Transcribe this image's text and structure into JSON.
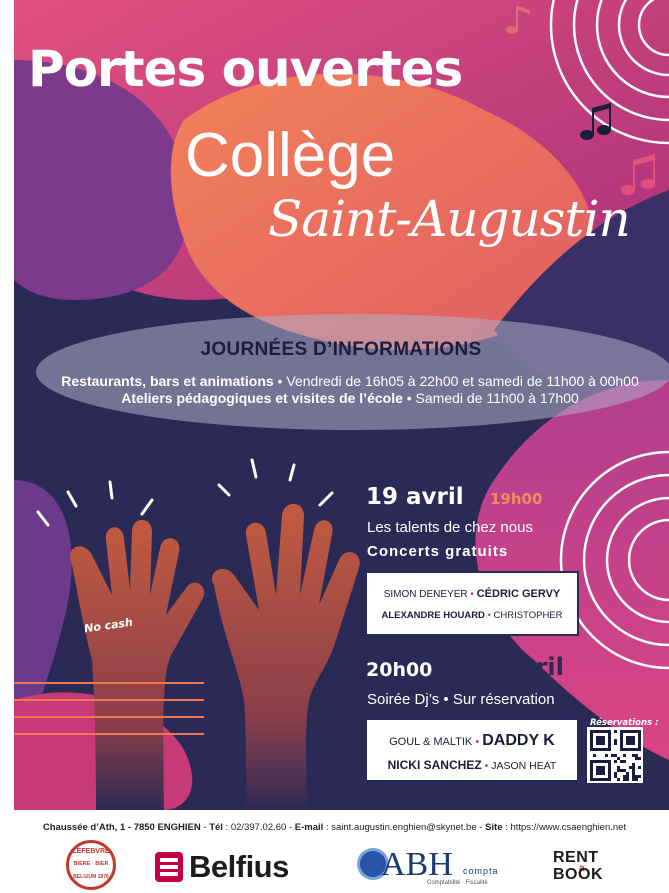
{
  "title": {
    "line1": "Portes ouvertes",
    "line2": "Collège",
    "line3": "Saint-Augustin"
  },
  "info": {
    "heading": "JOURNÉES D’INFORMATIONS",
    "line1_bold": "Restaurants, bars et animations",
    "line1_rest": " • Vendredi de 16h05 à 22h00 et samedi de 11h00 à 00h00",
    "line2_bold": "Ateliers pédagogiques et visites de l’école",
    "line2_rest": " • Samedi de 11h00 à 17h00"
  },
  "event1": {
    "date": "19 avril",
    "time": "19h00",
    "subtitle": "Les talents de chez nous",
    "subtitle2": "Concerts gratuits",
    "artist1": "SIMON DENEYER",
    "artist2": "CÉDRIC GERVY",
    "artist3": "ALEXANDRE HOUARD",
    "artist4": "CHRISTOPHER",
    "sep": "•"
  },
  "event2": {
    "time": "20h00",
    "date": "20 avril",
    "subtitle": "Soirée Dj’s • Sur réservation",
    "artist1": "GOUL & MALTIK",
    "artist2": "DADDY K",
    "artist3": "NICKI SANCHEZ",
    "artist4": "JASON HEAT",
    "sep": "•"
  },
  "no_cash": "No cash",
  "reservations_label": "Réservations :",
  "footer": {
    "address": "Chaussée d’Ath, 1 - 7850 ENGHIEN",
    "tel_label": "Tél",
    "tel": "02/397.02.60",
    "email_label": "E-mail",
    "email": "saint.augustin.enghien@skynet.be",
    "site_label": "Site",
    "site": "https://www.csaenghien.net"
  },
  "sponsors": {
    "lefebvre_top": "LEFEBVRE",
    "lefebvre_mid": "BIÈRE · BIER",
    "lefebvre_bottom": "BELGIUM 1876",
    "belfius": "Belfius",
    "abh": "ABH",
    "abh_compta": "compta",
    "abh_sub": "Comptabilité · Fiscalité",
    "rent": "RENT",
    "book": "BOOK",
    "rent_a": "a"
  },
  "colors": {
    "navy": "#2b2a56",
    "magenta": "#c73a78",
    "orange": "#ee7650",
    "purple": "#7b3a8a",
    "hand": "#c25b40"
  }
}
